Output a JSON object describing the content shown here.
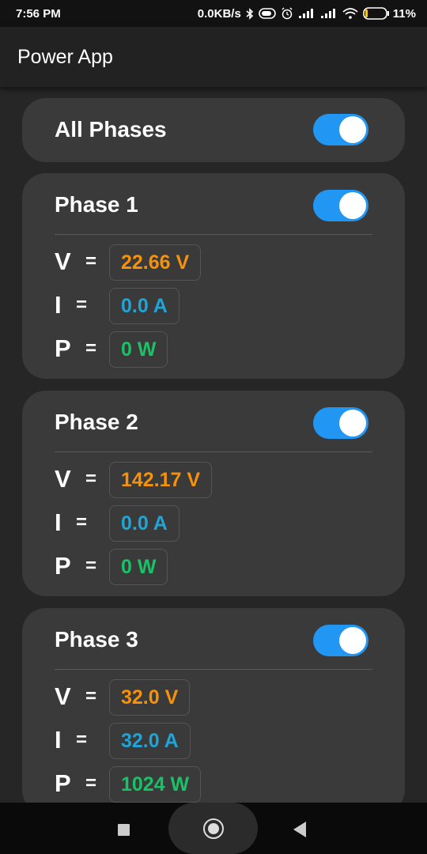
{
  "status_bar": {
    "time": "7:56 PM",
    "net_speed": "0.0KB/s",
    "battery_percent": "11%",
    "icons": [
      "bluetooth-icon",
      "toggle-status-icon",
      "alarm-icon",
      "signal-icon",
      "signal-icon",
      "wifi-icon",
      "battery-icon"
    ]
  },
  "app_bar": {
    "title": "Power App"
  },
  "all_phases": {
    "label": "All Phases",
    "enabled": true
  },
  "phases": [
    {
      "title": "Phase 1",
      "enabled": true,
      "v_symbol": "V",
      "i_symbol": "I",
      "p_symbol": "P",
      "eq": "=",
      "voltage": "22.66 V",
      "current": "0.0 A",
      "power": "0 W"
    },
    {
      "title": "Phase 2",
      "enabled": true,
      "v_symbol": "V",
      "i_symbol": "I",
      "p_symbol": "P",
      "eq": "=",
      "voltage": "142.17 V",
      "current": "0.0 A",
      "power": "0 W"
    },
    {
      "title": "Phase 3",
      "enabled": true,
      "v_symbol": "V",
      "i_symbol": "I",
      "p_symbol": "P",
      "eq": "=",
      "voltage": "32.0 V",
      "current": "32.0 A",
      "power": "1024 W"
    }
  ],
  "colors": {
    "toggle_on": "#2196f3",
    "voltage": "#f5920a",
    "current": "#20a4d6",
    "power": "#19c266",
    "card": "#3a3a3a",
    "background": "#262626"
  },
  "nav_bar": {
    "icons": [
      "recents-square-icon",
      "home-circle-icon",
      "back-triangle-icon"
    ]
  }
}
